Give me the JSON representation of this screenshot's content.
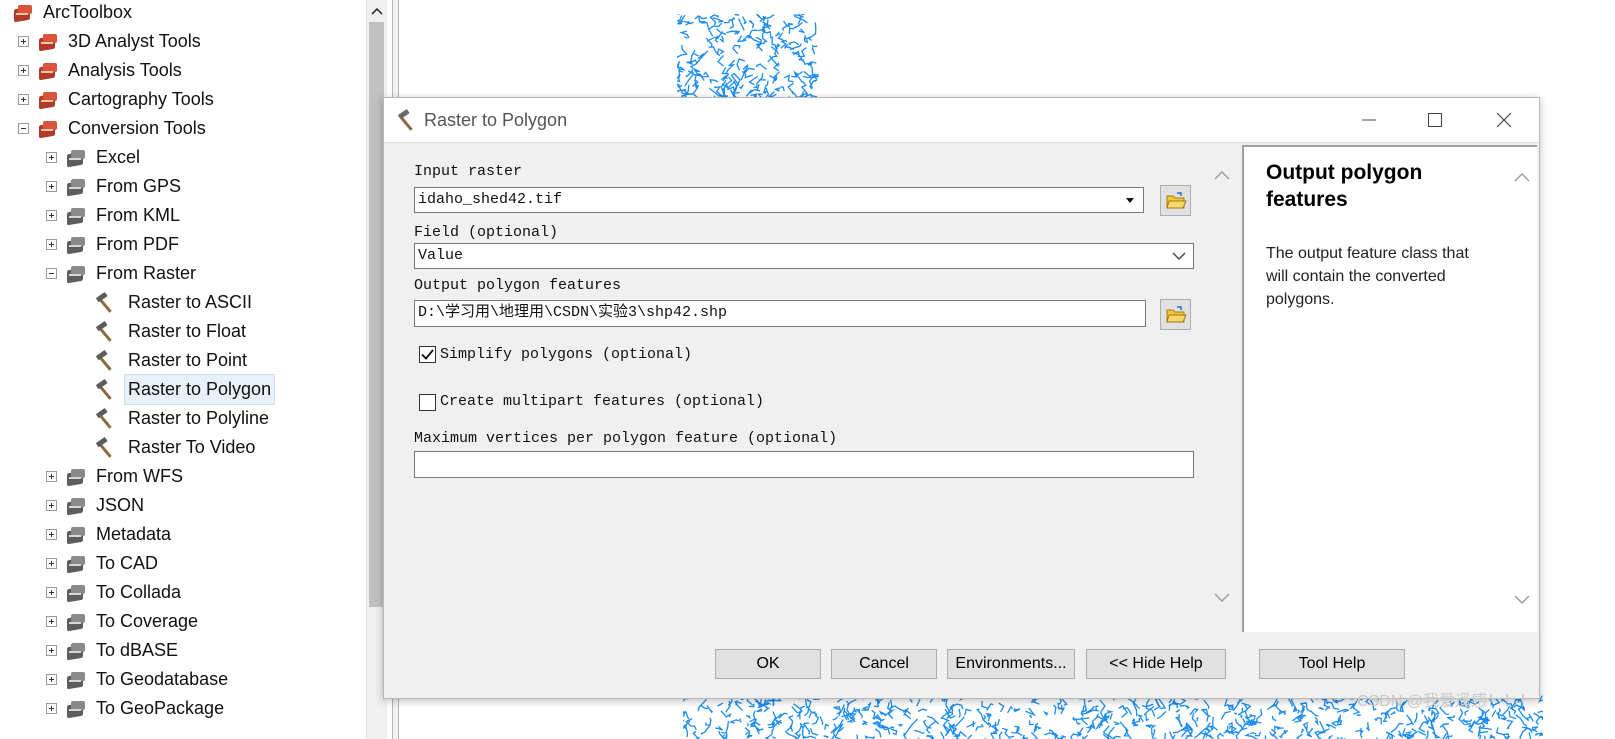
{
  "toolbox": {
    "root_label": "ArcToolbox",
    "items": [
      {
        "label": "3D Analyst Tools",
        "expander": "plus",
        "icon": "red"
      },
      {
        "label": "Analysis Tools",
        "expander": "plus",
        "icon": "red"
      },
      {
        "label": "Cartography Tools",
        "expander": "plus",
        "icon": "red"
      },
      {
        "label": "Conversion Tools",
        "expander": "minus",
        "icon": "red"
      },
      {
        "label": "Excel",
        "expander": "plus",
        "icon": "gray"
      },
      {
        "label": "From GPS",
        "expander": "plus",
        "icon": "gray"
      },
      {
        "label": "From KML",
        "expander": "plus",
        "icon": "gray"
      },
      {
        "label": "From PDF",
        "expander": "plus",
        "icon": "gray"
      },
      {
        "label": "From Raster",
        "expander": "minus",
        "icon": "gray"
      },
      {
        "label": "Raster to ASCII",
        "expander": "none",
        "icon": "hammer"
      },
      {
        "label": "Raster to Float",
        "expander": "none",
        "icon": "hammer"
      },
      {
        "label": "Raster to Point",
        "expander": "none",
        "icon": "hammer"
      },
      {
        "label": "Raster to Polygon",
        "expander": "none",
        "icon": "hammer",
        "selected": true
      },
      {
        "label": "Raster to Polyline",
        "expander": "none",
        "icon": "hammer"
      },
      {
        "label": "Raster To Video",
        "expander": "none",
        "icon": "hammer"
      },
      {
        "label": "From WFS",
        "expander": "plus",
        "icon": "gray"
      },
      {
        "label": "JSON",
        "expander": "plus",
        "icon": "gray"
      },
      {
        "label": "Metadata",
        "expander": "plus",
        "icon": "gray"
      },
      {
        "label": "To CAD",
        "expander": "plus",
        "icon": "gray"
      },
      {
        "label": "To Collada",
        "expander": "plus",
        "icon": "gray"
      },
      {
        "label": "To Coverage",
        "expander": "plus",
        "icon": "gray"
      },
      {
        "label": "To dBASE",
        "expander": "plus",
        "icon": "gray"
      },
      {
        "label": "To Geodatabase",
        "expander": "plus",
        "icon": "gray"
      },
      {
        "label": "To GeoPackage",
        "expander": "plus",
        "icon": "gray"
      }
    ]
  },
  "dialog": {
    "title": "Raster to Polygon",
    "params": {
      "input_raster_label": "Input raster",
      "input_raster_value": "idaho_shed42.tif",
      "field_label": "Field (optional)",
      "field_value": "Value",
      "output_label": "Output polygon features",
      "output_value": "D:\\学习用\\地理用\\CSDN\\实验3\\shp42.shp",
      "simplify_label": "Simplify polygons (optional)",
      "simplify_checked": true,
      "multipart_label": "Create multipart features (optional)",
      "multipart_checked": false,
      "max_vertices_label": "Maximum vertices per polygon feature (optional)",
      "max_vertices_value": ""
    },
    "help": {
      "title": "Output polygon features",
      "text": "The output feature class that will contain the converted polygons."
    },
    "buttons": {
      "ok": "OK",
      "cancel": "Cancel",
      "environments": "Environments...",
      "hide_help": "<< Hide Help",
      "tool_help": "Tool Help"
    }
  },
  "watermark": "CSDN @我爱遥感！！！",
  "colors": {
    "map_features": "#1a8cf0",
    "selection_bg": "#e8f0fa",
    "toolbox_red": "#b23a2a"
  }
}
